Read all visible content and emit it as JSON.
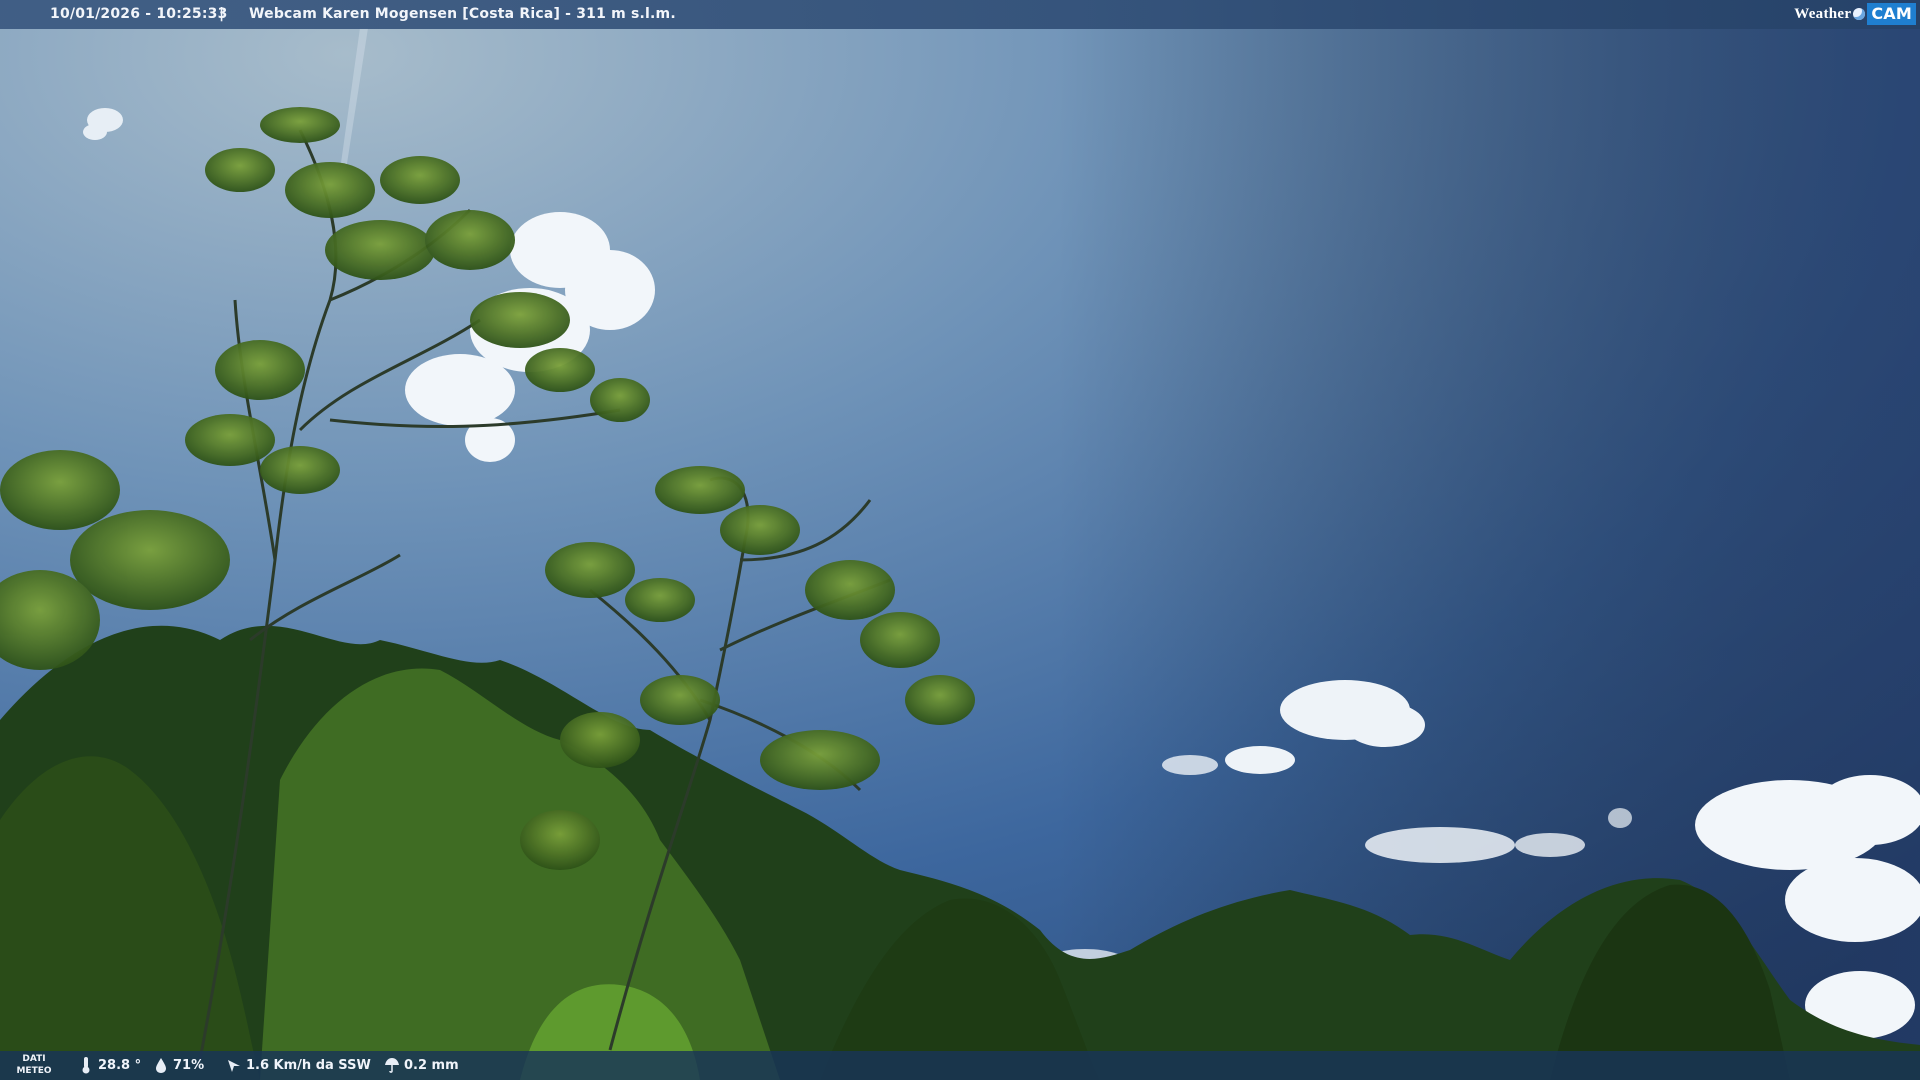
{
  "header": {
    "timestamp": "10/01/2026 - 10:25:33",
    "separator": "|",
    "camera_title": "Webcam Karen Mogensen [Costa Rica] - 311 m s.l.m."
  },
  "logo": {
    "weather": "Weather",
    "cam": "CAM"
  },
  "footer": {
    "label_line1": "DATI",
    "label_line2": "METEO",
    "temperature": "28.8 °",
    "humidity": "71%",
    "wind": "1.6 Km/h da SSW",
    "rain": "0.2 mm"
  },
  "colors": {
    "sky_top_left": "#9fb6c7",
    "sky_right": "#2c4570",
    "sky_lower": "#3a6aa4",
    "foliage_dark": "#1d3a12",
    "foliage_light": "#5a8a2a",
    "accent_logo": "#1f7fd0"
  }
}
